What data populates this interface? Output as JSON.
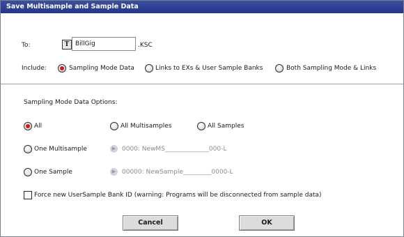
{
  "dialog": {
    "title": "Save Multisample and Sample Data"
  },
  "to": {
    "label": "To:",
    "filename": "BillGig",
    "extension": ".KSC"
  },
  "include": {
    "label": "Include:",
    "options": [
      {
        "label": "Sampling Mode Data",
        "selected": true
      },
      {
        "label": "Links to EXs & User Sample Banks",
        "selected": false
      },
      {
        "label": "Both Sampling Mode & Links",
        "selected": false
      }
    ]
  },
  "options_section": {
    "heading": "Sampling Mode Data Options:",
    "all": {
      "label": "All",
      "selected": true
    },
    "all_multisamples": {
      "label": "All Multisamples",
      "selected": false
    },
    "all_samples": {
      "label": "All Samples",
      "selected": false
    },
    "one_multisample": {
      "label": "One Multisample",
      "selected": false,
      "value": "0000: NewMS______________000-L"
    },
    "one_sample": {
      "label": "One Sample",
      "selected": false,
      "value": "00000: NewSample_________0000-L"
    }
  },
  "force_bank": {
    "label": "Force new UserSample Bank ID (warning: Programs will be disconnected from sample data)",
    "checked": false
  },
  "buttons": {
    "cancel": "Cancel",
    "ok": "OK"
  }
}
